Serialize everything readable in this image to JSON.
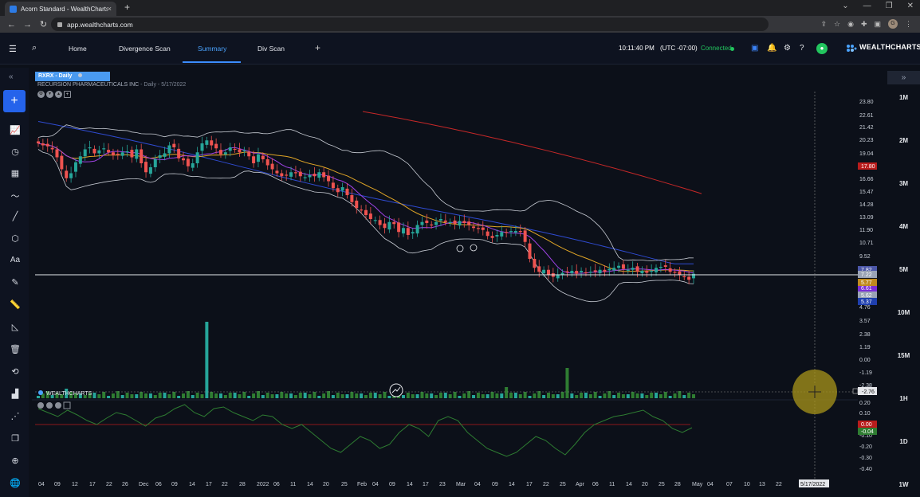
{
  "browser": {
    "tab_title": "Acorn Standard - WealthCharts",
    "tab_close": "×",
    "new_tab": "+",
    "url": "app.wealthcharts.com",
    "back": "←",
    "forward": "→",
    "reload": "↻",
    "window_controls": [
      "⌄",
      "—",
      "❐",
      "✕"
    ],
    "profile_initial": "G"
  },
  "app": {
    "tabs": [
      {
        "label": "Home",
        "active": false
      },
      {
        "label": "Divergence Scan",
        "active": false
      },
      {
        "label": "Summary",
        "active": true
      },
      {
        "label": "Div Scan",
        "active": false
      }
    ],
    "add_tab": "+",
    "time": "10:11:40 PM",
    "timezone": "(UTC -07:00)",
    "connection": "Connected",
    "brand": "WEALTHCHARTS"
  },
  "chart": {
    "symbol_label": "RXRX - Daily",
    "company": "RECURSION PHARMACEUTICALS INC",
    "company_suffix": " - Daily - 5/17/2022",
    "watermark": "WEALTHCHARTS",
    "accent": "#3b8cff",
    "up_color": "#26a69a",
    "down_color": "#ef5350",
    "price_axis_labels": [
      "23.80",
      "22.61",
      "21.42",
      "20.23",
      "19.04",
      "16.66",
      "15.47",
      "14.28",
      "13.09",
      "11.90",
      "10.71",
      "9.52",
      "4.76",
      "3.57",
      "2.38",
      "1.19",
      "0.00",
      "-1.19",
      "-2.38"
    ],
    "price_tags": [
      {
        "text": "17.80",
        "color": "#b91c1c"
      },
      {
        "text": "7.82",
        "color": "#4c57a8"
      },
      {
        "text": "7.22",
        "color": "#9aa3b5"
      },
      {
        "text": "6.61",
        "color": "#7b2ed6"
      },
      {
        "text": "5.77",
        "color": "#c08a1e"
      },
      {
        "text": "5.62",
        "color": "#9aa3b5"
      },
      {
        "text": "5.37",
        "color": "#1f3fae"
      }
    ],
    "crosshair_tag": "-2.76",
    "osc_axis_labels": [
      "0.20",
      "0.10",
      "-0.10",
      "-0.20",
      "-0.30",
      "-0.40"
    ],
    "osc_tags": [
      {
        "text": "0.00",
        "color": "#b91c1c"
      },
      {
        "text": "-0.04",
        "color": "#2f7d32"
      }
    ],
    "date_labels": [
      "04",
      "09",
      "12",
      "17",
      "22",
      "26",
      "Dec",
      "06",
      "09",
      "14",
      "17",
      "22",
      "28",
      "2022",
      "06",
      "11",
      "14",
      "20",
      "25",
      "Feb",
      "04",
      "09",
      "14",
      "17",
      "23",
      "Mar",
      "04",
      "09",
      "14",
      "17",
      "22",
      "25",
      "Apr",
      "06",
      "11",
      "14",
      "20",
      "25",
      "28",
      "May",
      "04",
      "07",
      "10",
      "13",
      "22"
    ],
    "crosshair_date": "5/17/2022"
  },
  "timeframes": [
    "1M",
    "2M",
    "3M",
    "4M",
    "5M",
    "10M",
    "15M",
    "1H",
    "1D",
    "1W"
  ],
  "chart_data": {
    "type": "candlestick",
    "title": "RXRX - Daily",
    "ylim": [
      4.2,
      23.8
    ],
    "close": [
      19.8,
      19.6,
      19.5,
      19.2,
      18.4,
      17.2,
      16.3,
      16.8,
      17.9,
      18.5,
      19.2,
      19.4,
      18.8,
      19.1,
      19.3,
      18.9,
      18.6,
      18.7,
      18.9,
      19.0,
      18.4,
      19.2,
      17.8,
      16.9,
      17.4,
      18.2,
      18.6,
      18.8,
      19.6,
      19.4,
      18.3,
      18.1,
      17.5,
      17.8,
      18.9,
      19.8,
      20.1,
      19.6,
      19.3,
      18.7,
      18.9,
      19.4,
      19.2,
      18.9,
      19.1,
      18.5,
      17.8,
      18.7,
      18.2,
      17.6,
      17.2,
      16.8,
      16.5,
      16.6,
      16.9,
      16.8,
      16.5,
      16.4,
      16.6,
      16.5,
      16.9,
      16.4,
      16.0,
      15.3,
      14.9,
      15.4,
      14.6,
      13.9,
      13.3,
      13.1,
      12.6,
      12.2,
      12.1,
      11.6,
      11.3,
      11.9,
      11.7,
      10.9,
      11.3,
      10.6,
      10.9,
      11.6,
      11.9,
      11.8,
      11.6,
      11.9,
      12.2,
      11.9,
      11.9,
      11.7,
      12.0,
      11.8,
      11.6,
      11.3,
      11.2,
      11.1,
      10.5,
      10.3,
      10.6,
      10.9,
      10.8,
      11.0,
      11.0,
      10.9,
      9.9,
      8.2,
      7.3,
      6.9,
      7.1,
      6.6,
      6.4,
      6.6,
      6.8,
      6.9,
      7.0,
      6.7,
      7.0,
      6.8,
      6.9,
      6.9,
      7.1,
      6.9,
      7.2,
      7.3,
      7.5,
      7.2,
      7.1,
      7.3,
      6.9,
      7.0,
      6.8,
      7.0,
      7.3,
      7.4,
      7.4,
      6.9,
      6.8,
      6.6,
      6.4,
      6.1,
      6.7
    ],
    "volume_note": "volume histogram below price",
    "overlays": [
      "Bollinger Bands",
      "SMA",
      "EMA",
      "200-day SMA"
    ]
  }
}
